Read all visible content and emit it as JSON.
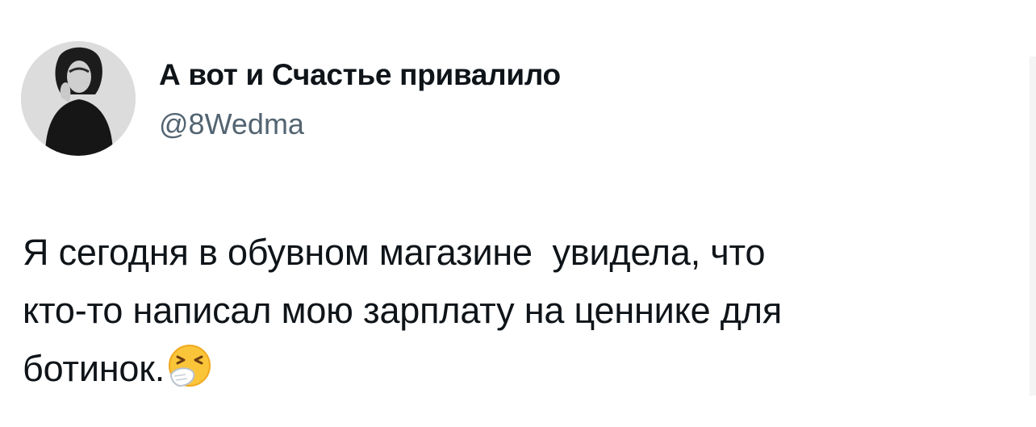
{
  "tweet": {
    "author": {
      "display_name": "А вот и Счастье привалило",
      "handle": "@8Wedma"
    },
    "text_lines": [
      "Я сегодня в обувном магазине  увидела, что",
      "кто-то написал мою зарплату на ценнике для",
      "ботинок."
    ],
    "emoji": "sneezing-face-icon"
  }
}
